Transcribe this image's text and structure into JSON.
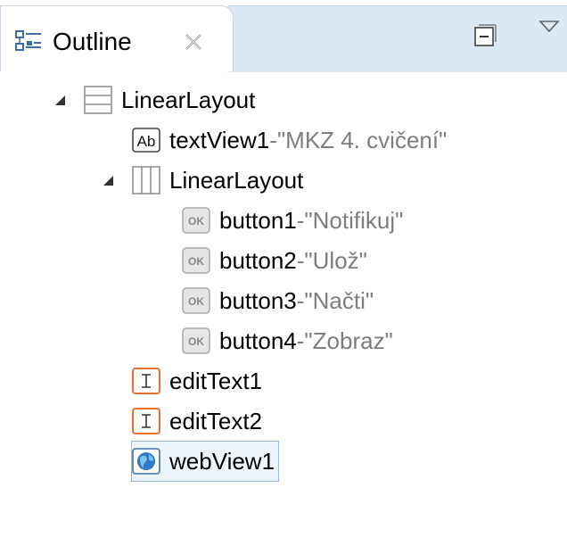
{
  "view": {
    "tab_label": "Outline",
    "tab_icon": "outline-icon",
    "close_icon": "close-icon",
    "collapse_icon": "collapse-all-icon",
    "menu_icon": "view-menu-icon"
  },
  "tree": {
    "separator": " - ",
    "nodes": [
      {
        "name": "LinearLayout",
        "detail": "",
        "icon": "linear-layout-vertical-icon",
        "expanded": true
      },
      {
        "name": "textView1",
        "detail": "\"MKZ 4. cvičení\"",
        "icon": "textview-icon"
      },
      {
        "name": "LinearLayout",
        "detail": "",
        "icon": "linear-layout-horizontal-icon",
        "expanded": true
      },
      {
        "name": "button1",
        "detail": "\"Notifikuj\"",
        "icon": "button-icon"
      },
      {
        "name": "button2",
        "detail": "\"Ulož\"",
        "icon": "button-icon"
      },
      {
        "name": "button3",
        "detail": "\"Načti\"",
        "icon": "button-icon"
      },
      {
        "name": "button4",
        "detail": "\"Zobraz\"",
        "icon": "button-icon"
      },
      {
        "name": "editText1",
        "detail": "",
        "icon": "edittext-icon"
      },
      {
        "name": "editText2",
        "detail": "",
        "icon": "edittext-icon"
      },
      {
        "name": "webView1",
        "detail": "",
        "icon": "webview-icon",
        "selected": true
      }
    ]
  },
  "colors": {
    "tabstrip": "#dde8f5",
    "detail_text": "#7d7d7d",
    "edittext_accent": "#e8722b",
    "selection": "#9bb6e0"
  }
}
